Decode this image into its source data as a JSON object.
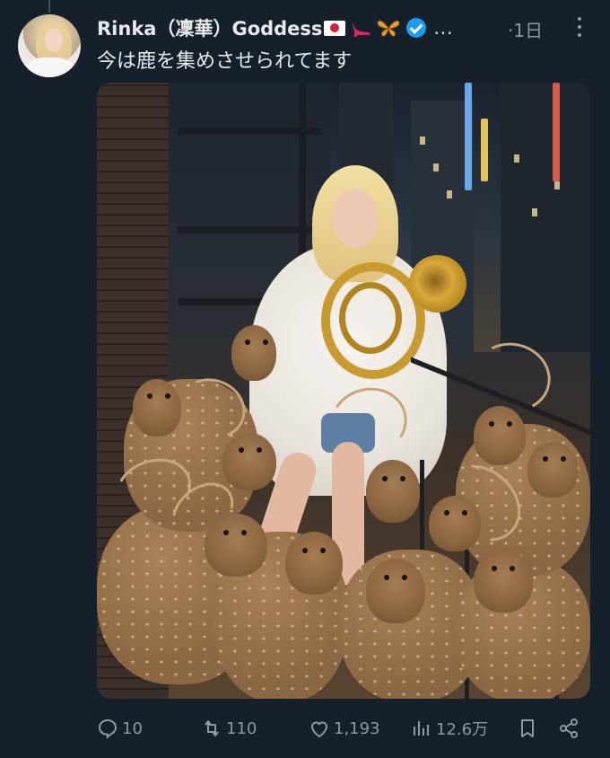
{
  "tweet": {
    "author_name": "Rinka（凜華）Goddess",
    "author_emojis": [
      "japan-flag",
      "high-heel",
      "butterfly"
    ],
    "verified": true,
    "name_ellipsis": "...",
    "time_prefix": "·",
    "time": "1日",
    "text": "今は鹿を集めさせられてます",
    "media_description_icons": "photo"
  },
  "actions": {
    "replies": "10",
    "retweets": "110",
    "likes": "1,193",
    "views": "12.6万"
  },
  "colors": {
    "background": "#15202b",
    "text": "#e7e9ea",
    "secondary": "#8b98a5",
    "verified": "#1d9bf0"
  }
}
